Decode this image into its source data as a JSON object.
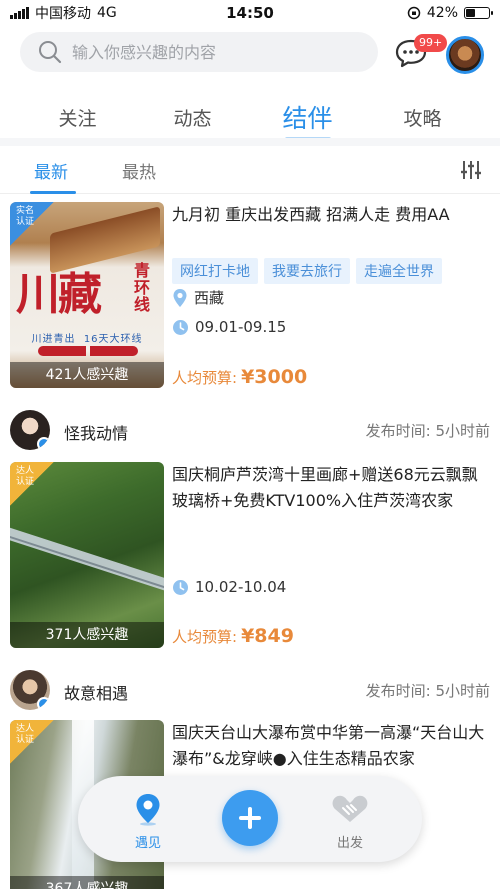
{
  "status_bar": {
    "carrier": "中国移动",
    "network": "4G",
    "time": "14:50",
    "battery": "42%",
    "battery_level": 0.42
  },
  "header": {
    "search_placeholder": "输入你感兴趣的内容",
    "message_badge": "99+"
  },
  "main_tabs": [
    {
      "label": "关注",
      "active": false
    },
    {
      "label": "动态",
      "active": false
    },
    {
      "label": "结伴",
      "active": true
    },
    {
      "label": "攻略",
      "active": false
    }
  ],
  "sub_tabs": [
    {
      "label": "最新",
      "active": true
    },
    {
      "label": "最热",
      "active": false
    }
  ],
  "posts": [
    {
      "badge": "实名认证",
      "title": "九月初 重庆出发西藏 招满人走 费用AA",
      "tags": [
        "网红打卡地",
        "我要去旅行",
        "走遍全世界"
      ],
      "location": "西藏",
      "dates": "09.01-09.15",
      "budget_label": "人均预算:",
      "budget": "¥3000",
      "interested": "421人感兴趣",
      "poster": {
        "title": "川藏",
        "subtitle": "青环线",
        "route": "川进青出",
        "duration": "16天大环线"
      }
    },
    {
      "user": "怪我动情",
      "published": "发布时间:  5小时前",
      "badge": "达人认证",
      "title": "国庆桐庐芦茨湾十里画廊+赠送68元云飘飘玻璃桥+免费KTV100%入住芦茨湾农家",
      "dates": "10.02-10.04",
      "budget_label": "人均预算:",
      "budget": "¥849",
      "interested": "371人感兴趣"
    },
    {
      "user": "故意相遇",
      "published": "发布时间:  5小时前",
      "badge": "达人认证",
      "title": "国庆天台山大瀑布赏中华第一高瀑“天台山大瀑布”&龙穿峡●入住生态精品农家",
      "interested": "367人感兴趣"
    }
  ],
  "bottom_nav": {
    "left": "遇见",
    "right": "出发"
  },
  "colors": {
    "accent": "#2a8fe8",
    "budget": "#e8893a",
    "badge_red": "#f14a4a",
    "gold": "#f1b43a"
  }
}
